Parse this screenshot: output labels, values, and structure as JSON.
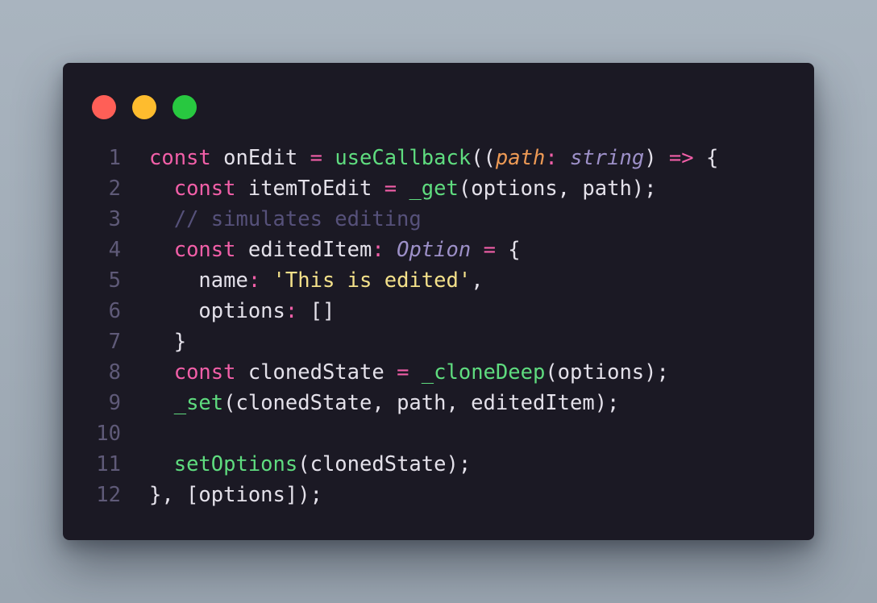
{
  "colors": {
    "background": "#a5b0bb",
    "window": "#1b1924",
    "close": "#ff5f57",
    "minimize": "#febc2e",
    "maximize": "#28c840",
    "keyword": "#f25fa8",
    "function": "#5fdc7f",
    "string": "#f3e08a",
    "comment": "#56517a",
    "type": "#9d90c8",
    "param": "#ee9a55",
    "text": "#e4e1ea",
    "line_number": "#5f5a78"
  },
  "window_controls": [
    {
      "name": "close",
      "icon": "close-dot-icon"
    },
    {
      "name": "minimize",
      "icon": "minimize-dot-icon"
    },
    {
      "name": "maximize",
      "icon": "maximize-dot-icon"
    }
  ],
  "code": {
    "language": "typescript",
    "lines": [
      {
        "n": "1",
        "tokens": [
          {
            "t": "kw",
            "v": "const"
          },
          {
            "t": "pl",
            "v": " onEdit "
          },
          {
            "t": "op",
            "v": "="
          },
          {
            "t": "pl",
            "v": " "
          },
          {
            "t": "fn",
            "v": "useCallback"
          },
          {
            "t": "pl",
            "v": "(("
          },
          {
            "t": "prm",
            "v": "path"
          },
          {
            "t": "op",
            "v": ":"
          },
          {
            "t": "pl",
            "v": " "
          },
          {
            "t": "ty",
            "v": "string"
          },
          {
            "t": "pl",
            "v": ") "
          },
          {
            "t": "op",
            "v": "=>"
          },
          {
            "t": "pl",
            "v": " {"
          }
        ]
      },
      {
        "n": "2",
        "tokens": [
          {
            "t": "pl",
            "v": "  "
          },
          {
            "t": "kw",
            "v": "const"
          },
          {
            "t": "pl",
            "v": " itemToEdit "
          },
          {
            "t": "op",
            "v": "="
          },
          {
            "t": "pl",
            "v": " "
          },
          {
            "t": "fn",
            "v": "_get"
          },
          {
            "t": "pl",
            "v": "(options, path);"
          }
        ]
      },
      {
        "n": "3",
        "tokens": [
          {
            "t": "pl",
            "v": "  "
          },
          {
            "t": "cm",
            "v": "// simulates editing"
          }
        ]
      },
      {
        "n": "4",
        "tokens": [
          {
            "t": "pl",
            "v": "  "
          },
          {
            "t": "kw",
            "v": "const"
          },
          {
            "t": "pl",
            "v": " editedItem"
          },
          {
            "t": "op",
            "v": ":"
          },
          {
            "t": "pl",
            "v": " "
          },
          {
            "t": "ty",
            "v": "Option"
          },
          {
            "t": "pl",
            "v": " "
          },
          {
            "t": "op",
            "v": "="
          },
          {
            "t": "pl",
            "v": " {"
          }
        ]
      },
      {
        "n": "5",
        "tokens": [
          {
            "t": "pl",
            "v": "    name"
          },
          {
            "t": "op",
            "v": ":"
          },
          {
            "t": "pl",
            "v": " "
          },
          {
            "t": "str",
            "v": "'This is edited'"
          },
          {
            "t": "pl",
            "v": ","
          }
        ]
      },
      {
        "n": "6",
        "tokens": [
          {
            "t": "pl",
            "v": "    options"
          },
          {
            "t": "op",
            "v": ":"
          },
          {
            "t": "pl",
            "v": " []"
          }
        ]
      },
      {
        "n": "7",
        "tokens": [
          {
            "t": "pl",
            "v": "  }"
          }
        ]
      },
      {
        "n": "8",
        "tokens": [
          {
            "t": "pl",
            "v": "  "
          },
          {
            "t": "kw",
            "v": "const"
          },
          {
            "t": "pl",
            "v": " clonedState "
          },
          {
            "t": "op",
            "v": "="
          },
          {
            "t": "pl",
            "v": " "
          },
          {
            "t": "fn",
            "v": "_cloneDeep"
          },
          {
            "t": "pl",
            "v": "(options);"
          }
        ]
      },
      {
        "n": "9",
        "tokens": [
          {
            "t": "pl",
            "v": "  "
          },
          {
            "t": "fn",
            "v": "_set"
          },
          {
            "t": "pl",
            "v": "(clonedState, path, editedItem);"
          }
        ]
      },
      {
        "n": "10",
        "tokens": []
      },
      {
        "n": "11",
        "tokens": [
          {
            "t": "pl",
            "v": "  "
          },
          {
            "t": "fn",
            "v": "setOptions"
          },
          {
            "t": "pl",
            "v": "(clonedState);"
          }
        ]
      },
      {
        "n": "12",
        "tokens": [
          {
            "t": "pl",
            "v": "}, [options]);"
          }
        ]
      }
    ]
  }
}
